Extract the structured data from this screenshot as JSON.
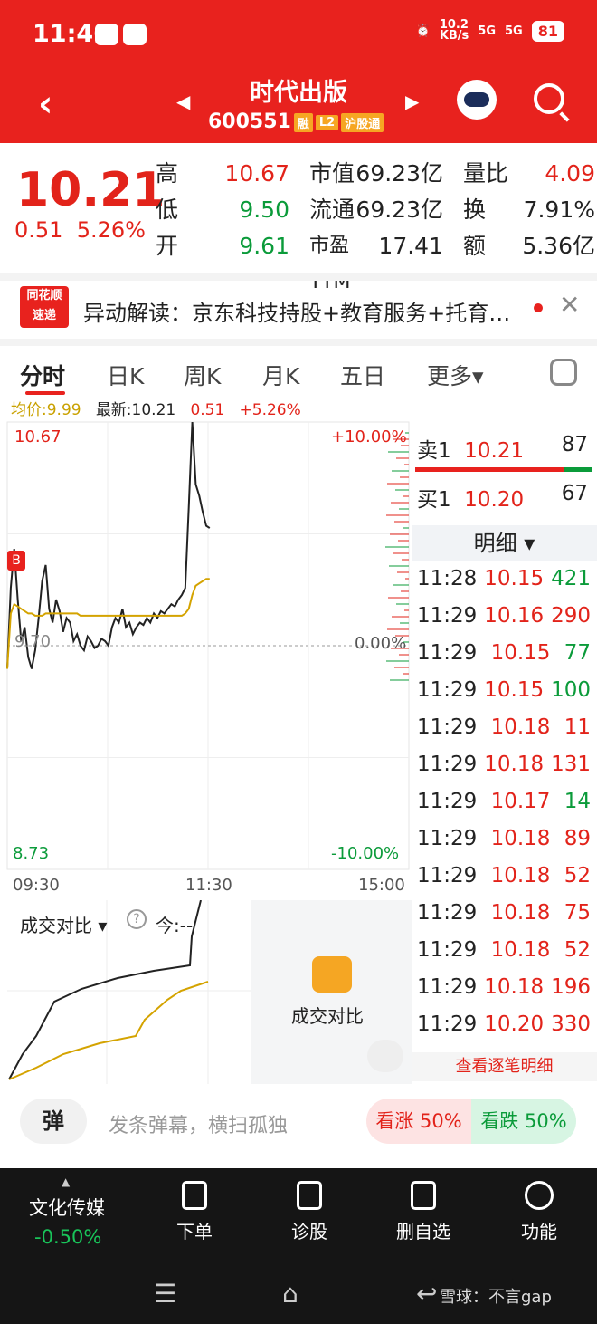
{
  "status": {
    "time": "11:46",
    "net_speed": "10.2\nKB/s",
    "sig1": "5G",
    "sig2": "5G",
    "battery": "81"
  },
  "header": {
    "stock_name": "时代出版",
    "code": "600551",
    "tags": [
      "融",
      "L2",
      "沪股通"
    ]
  },
  "quote": {
    "price": "10.21",
    "change": "0.51",
    "change_pct": "5.26%",
    "col1": [
      {
        "k": "高",
        "v": "10.67"
      },
      {
        "k": "低",
        "v": "9.50"
      },
      {
        "k": "开",
        "v": "9.61"
      }
    ],
    "col2": [
      {
        "k": "市值",
        "v": "69.23亿"
      },
      {
        "k": "流通",
        "v": "69.23亿"
      },
      {
        "k": "市盈TTM",
        "v": "17.41"
      }
    ],
    "col3": [
      {
        "k": "量比",
        "v": "4.09"
      },
      {
        "k": "换",
        "v": "7.91%"
      },
      {
        "k": "额",
        "v": "5.36亿"
      }
    ]
  },
  "news": {
    "logo_line1": "同花顺",
    "logo_line2": "速递",
    "text": "异动解读：京东科技持股+教育服务+托育…"
  },
  "tabs": [
    "分时",
    "日K",
    "周K",
    "月K",
    "五日",
    "更多▾"
  ],
  "info": {
    "avg_label": "均价:9.99",
    "latest_label": "最新:10.21",
    "chg": "0.51",
    "pct": "+5.26%"
  },
  "chart_data": {
    "type": "line",
    "x_ticks": [
      "09:30",
      "11:30",
      "15:00"
    ],
    "y_labels_left": [
      "10.67",
      "9.70",
      "8.73"
    ],
    "y_labels_right": [
      "+10.00%",
      "0.00%",
      "-10.00%"
    ],
    "ylim": [
      8.73,
      10.67
    ],
    "prev_close": 9.7,
    "marker": "B",
    "series": [
      {
        "values": [
          9.6,
          9.95,
          10.12,
          9.9,
          9.72,
          9.78,
          9.65,
          9.6,
          9.68,
          9.82,
          9.98,
          10.05,
          9.86,
          9.8,
          9.9,
          9.85,
          9.76,
          9.82,
          9.8,
          9.72,
          9.75,
          9.7,
          9.68,
          9.74,
          9.72,
          9.69,
          9.7,
          9.73,
          9.72,
          9.7,
          9.78,
          9.82,
          9.8,
          9.86,
          9.78,
          9.8,
          9.75,
          9.78,
          9.8,
          9.79,
          9.82,
          9.8,
          9.84,
          9.82,
          9.85,
          9.84,
          9.86,
          9.88,
          9.87,
          9.9,
          9.92,
          9.95,
          10.3,
          10.67,
          10.4,
          10.35,
          10.28,
          10.22,
          10.21
        ]
      },
      {
        "values": [
          9.6,
          9.84,
          9.88,
          9.87,
          9.86,
          9.85,
          9.84,
          9.84,
          9.83,
          9.83,
          9.83,
          9.84,
          9.84,
          9.84,
          9.84,
          9.84,
          9.84,
          9.84,
          9.84,
          9.84,
          9.84,
          9.83,
          9.83,
          9.83,
          9.83,
          9.83,
          9.83,
          9.83,
          9.83,
          9.83,
          9.83,
          9.83,
          9.83,
          9.83,
          9.83,
          9.83,
          9.83,
          9.83,
          9.83,
          9.83,
          9.83,
          9.83,
          9.83,
          9.83,
          9.83,
          9.83,
          9.83,
          9.83,
          9.83,
          9.83,
          9.83,
          9.84,
          9.86,
          9.92,
          9.96,
          9.97,
          9.98,
          9.99,
          9.99
        ]
      }
    ]
  },
  "book": {
    "sell": {
      "label": "卖1",
      "price": "10.21",
      "vol": "87"
    },
    "buy": {
      "label": "买1",
      "price": "10.20",
      "vol": "67"
    },
    "detail_label": "明细 ▾",
    "trades": [
      {
        "t": "11:28",
        "p": "10.15",
        "v": "421",
        "c": "green"
      },
      {
        "t": "11:29",
        "p": "10.16",
        "v": "290",
        "c": "red"
      },
      {
        "t": "11:29",
        "p": "10.15",
        "v": "77",
        "c": "green"
      },
      {
        "t": "11:29",
        "p": "10.15",
        "v": "100",
        "c": "green"
      },
      {
        "t": "11:29",
        "p": "10.18",
        "v": "11",
        "c": "red"
      },
      {
        "t": "11:29",
        "p": "10.18",
        "v": "131",
        "c": "red"
      },
      {
        "t": "11:29",
        "p": "10.17",
        "v": "14",
        "c": "green"
      },
      {
        "t": "11:29",
        "p": "10.18",
        "v": "89",
        "c": "red"
      },
      {
        "t": "11:29",
        "p": "10.18",
        "v": "52",
        "c": "red"
      },
      {
        "t": "11:29",
        "p": "10.18",
        "v": "75",
        "c": "red"
      },
      {
        "t": "11:29",
        "p": "10.18",
        "v": "52",
        "c": "red"
      },
      {
        "t": "11:29",
        "p": "10.18",
        "v": "196",
        "c": "red"
      },
      {
        "t": "11:29",
        "p": "10.20",
        "v": "330",
        "c": "red"
      }
    ],
    "more_label": "查看逐笔明细"
  },
  "volume": {
    "label": "成交对比 ▾",
    "help": "?",
    "today": "今:-- ",
    "lock_label": "成交对比"
  },
  "comment": {
    "dan": "弹",
    "placeholder": "发条弹幕，横扫孤独",
    "up": "看涨 50%",
    "down": "看跌 50%"
  },
  "bottom": {
    "sector": "文化传媒",
    "sector_pct": "-0.50%",
    "items": [
      "下单",
      "诊股",
      "删自选",
      "功能"
    ],
    "watermark": "雪球：不言gap"
  },
  "colors": {
    "brand_red": "#e8221e",
    "up": "#e2231a",
    "down": "#0b9b3a",
    "avg": "#d4a300"
  }
}
